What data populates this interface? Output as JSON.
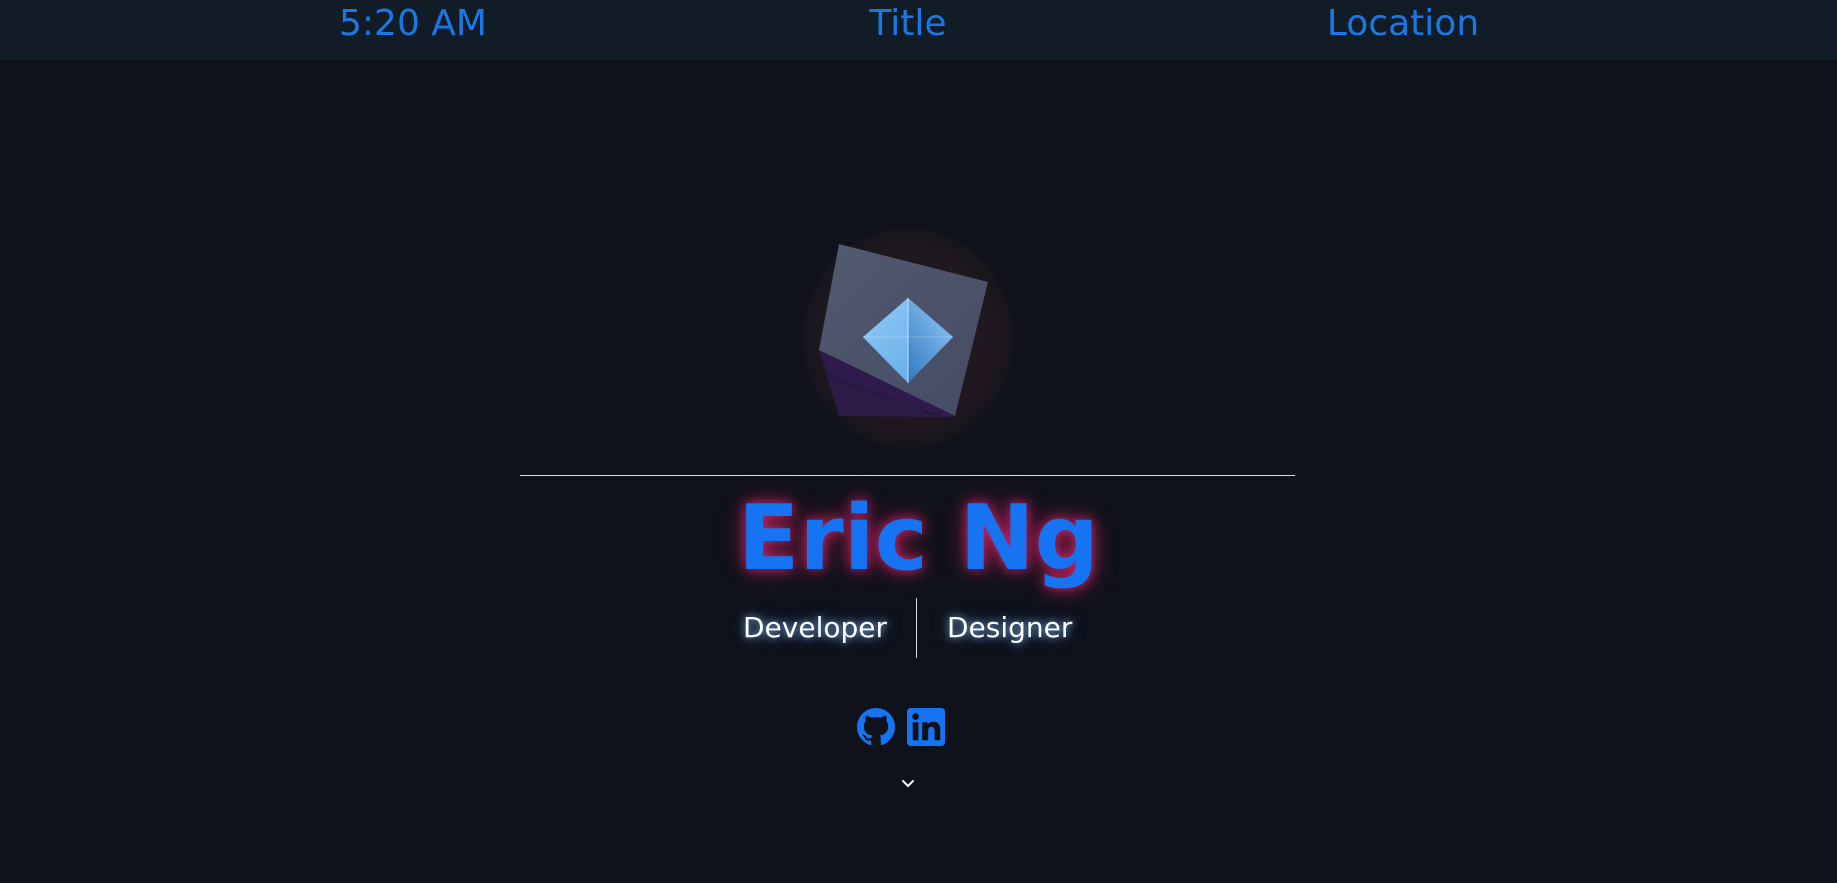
{
  "nav": {
    "time": "5:20 AM",
    "title": "Title",
    "location": "Location"
  },
  "hero": {
    "name": "Eric Ng",
    "roles": [
      "Developer",
      "Designer"
    ]
  },
  "social": {
    "github_icon": "github-icon",
    "linkedin_icon": "linkedin-icon"
  },
  "scroll": {
    "icon": "chevron-down-icon"
  },
  "colors": {
    "background": "#0f121b",
    "topbar": "#111c26",
    "accent_blue": "#1673f2",
    "name_glow": "#ff2878",
    "role_glow": "#8cc8ff"
  }
}
